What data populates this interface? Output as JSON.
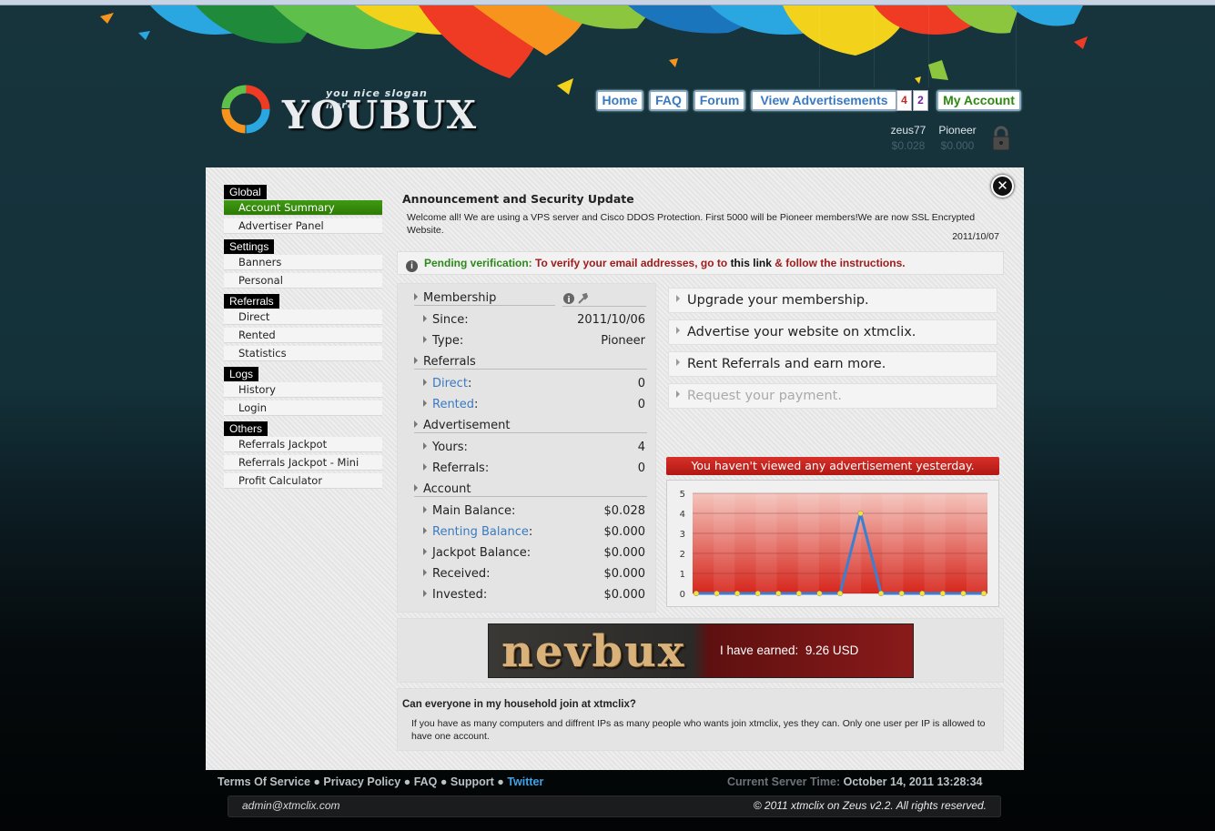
{
  "site": {
    "logo_text": "YOUBUX",
    "slogan": "you nice slogan here"
  },
  "topnav": {
    "home": "Home",
    "faq": "FAQ",
    "forum": "Forum",
    "view_ads": "View Advertisements",
    "ads_count_1": "4",
    "ads_count_2": "2",
    "my_account": "My Account"
  },
  "user": {
    "name": "zeus77",
    "balance": "$0.028",
    "membership": "Pioneer",
    "membership_balance": "$0.000"
  },
  "sidebar": {
    "groups": [
      {
        "title": "Global",
        "items": [
          "Account Summary",
          "Advertiser Panel"
        ]
      },
      {
        "title": "Settings",
        "items": [
          "Banners",
          "Personal"
        ]
      },
      {
        "title": "Referrals",
        "items": [
          "Direct",
          "Rented",
          "Statistics"
        ]
      },
      {
        "title": "Logs",
        "items": [
          "History",
          "Login"
        ]
      },
      {
        "title": "Others",
        "items": [
          "Referrals Jackpot",
          "Referrals Jackpot - Mini",
          "Profit Calculator"
        ]
      }
    ]
  },
  "announcement": {
    "title": "Announcement and Security Update",
    "body": "Welcome all! We are using a VPS server and Cisco DDOS Protection. First 5000 will be Pioneer members!We are now SSL Encrypted Website.",
    "date": "2011/10/07"
  },
  "pending": {
    "label": "Pending verification:",
    "text1": "To verify your email addresses, go to",
    "link": "this link",
    "text2": "& follow the instructions."
  },
  "stats": {
    "membership": {
      "title": "Membership",
      "since_label": "Since:",
      "since": "2011/10/06",
      "type_label": "Type:",
      "type": "Pioneer"
    },
    "referrals": {
      "title": "Referrals",
      "direct_label": "Direct",
      "direct": "0",
      "rented_label": "Rented",
      "rented": "0"
    },
    "advertisement": {
      "title": "Advertisement",
      "yours_label": "Yours:",
      "yours": "4",
      "referrals_label": "Referrals:",
      "referrals": "0"
    },
    "account": {
      "title": "Account",
      "main_label": "Main Balance:",
      "main": "$0.028",
      "renting_label": "Renting Balance",
      "renting": "$0.000",
      "jackpot_label": "Jackpot Balance:",
      "jackpot": "$0.000",
      "received_label": "Received:",
      "received": "$0.000",
      "invested_label": "Invested:",
      "invested": "$0.000"
    }
  },
  "actions": {
    "upgrade": "Upgrade your membership.",
    "advertise": "Advertise your website on xtmclix.",
    "rent": "Rent Referrals and earn more.",
    "payment": "Request your payment."
  },
  "warning": "You haven't viewed any advertisement yesterday.",
  "chart_data": {
    "type": "line",
    "x": [
      1,
      2,
      3,
      4,
      5,
      6,
      7,
      8,
      9,
      10,
      11,
      12,
      13,
      14,
      15
    ],
    "series": [
      {
        "values": [
          0,
          0,
          0,
          0,
          0,
          0,
          0,
          0,
          4,
          0,
          0,
          0,
          0,
          0,
          0
        ]
      }
    ],
    "yticks": [
      "0",
      "1",
      "2",
      "3",
      "4",
      "5"
    ],
    "ylim": [
      0,
      5
    ],
    "colors": {
      "line": "#3b7fd0",
      "point": "#f2e23a",
      "fill_top": "#f4c4bc",
      "fill_bottom": "#d6261c"
    }
  },
  "banner": {
    "logo": "nevbux",
    "earned_label": "I have earned:",
    "earned": "9.26 USD"
  },
  "faq": {
    "question": "Can everyone in my household join at xtmclix?",
    "answer": "If you have as many computers and diffrent IPs as many people who wants join xtmclix, yes they can. Only one user per IP is allowed to have one account."
  },
  "footer": {
    "tos": "Terms Of Service",
    "privacy": "Privacy Policy",
    "faq": "FAQ",
    "support": "Support",
    "twitter": "Twitter",
    "server_time_label": "Current Server Time:",
    "server_time": "October 14, 2011 13:28:34",
    "email": "admin@xtmclix.com",
    "copyright": "© 2011 xtmclix on Zeus v2.2. All rights reserved."
  }
}
